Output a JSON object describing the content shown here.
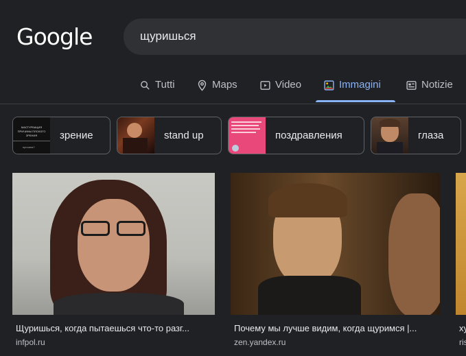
{
  "logo": "Google",
  "search": {
    "query": "щуришься"
  },
  "tabs": [
    {
      "label": "Tutti",
      "icon": "search-icon"
    },
    {
      "label": "Maps",
      "icon": "map-pin-icon"
    },
    {
      "label": "Video",
      "icon": "video-icon"
    },
    {
      "label": "Immagini",
      "icon": "image-icon",
      "active": true
    },
    {
      "label": "Notizie",
      "icon": "news-icon"
    }
  ],
  "chips": [
    {
      "label": "зрение",
      "thumb_lines": [
        "МАСТУРБАЦИЯ",
        "ПРИЧИНЫ ПЛОХОГО ЗРЕНИЯ",
        "причина?"
      ]
    },
    {
      "label": "stand up"
    },
    {
      "label": "поздравления"
    },
    {
      "label": "глаза"
    }
  ],
  "results": [
    {
      "title": "Щуришься, когда пытаешься что-то разг...",
      "source": "infpol.ru"
    },
    {
      "title": "Почему мы лучше видим, когда щуримся |...",
      "source": "zen.yandex.ru"
    },
    {
      "title": "хулиган",
      "source": "rise"
    }
  ],
  "colors": {
    "background": "#202124",
    "accent": "#8ab4f8",
    "search_bg": "#303134",
    "chip_border": "#5f6368"
  }
}
